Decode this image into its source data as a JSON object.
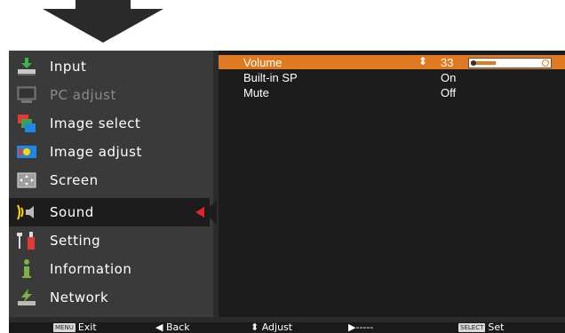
{
  "menu": {
    "items": [
      {
        "label": "Input",
        "icon": "input-icon",
        "enabled": true
      },
      {
        "label": "PC adjust",
        "icon": "pc-adjust-icon",
        "enabled": false
      },
      {
        "label": "Image select",
        "icon": "image-select-icon",
        "enabled": true
      },
      {
        "label": "Image adjust",
        "icon": "image-adjust-icon",
        "enabled": true
      },
      {
        "label": "Screen",
        "icon": "screen-icon",
        "enabled": true
      },
      {
        "label": "Sound",
        "icon": "sound-icon",
        "enabled": true,
        "selected": true
      },
      {
        "label": "Setting",
        "icon": "setting-icon",
        "enabled": true
      },
      {
        "label": "Information",
        "icon": "information-icon",
        "enabled": true
      },
      {
        "label": "Network",
        "icon": "network-icon",
        "enabled": true
      }
    ]
  },
  "sound": {
    "rows": [
      {
        "name": "Volume",
        "value": "33",
        "highlight": true
      },
      {
        "name": "Built-in SP",
        "value": "On"
      },
      {
        "name": "Mute",
        "value": "Off"
      }
    ],
    "volume_fraction": 0.33
  },
  "footer": {
    "exit_key": "MENU",
    "exit": "Exit",
    "back": "Back",
    "adjust": "Adjust",
    "next": "-----",
    "set_key": "SELECT",
    "set": "Set"
  },
  "colors": {
    "accent": "#e07a20",
    "selection_marker": "#e5242b"
  }
}
